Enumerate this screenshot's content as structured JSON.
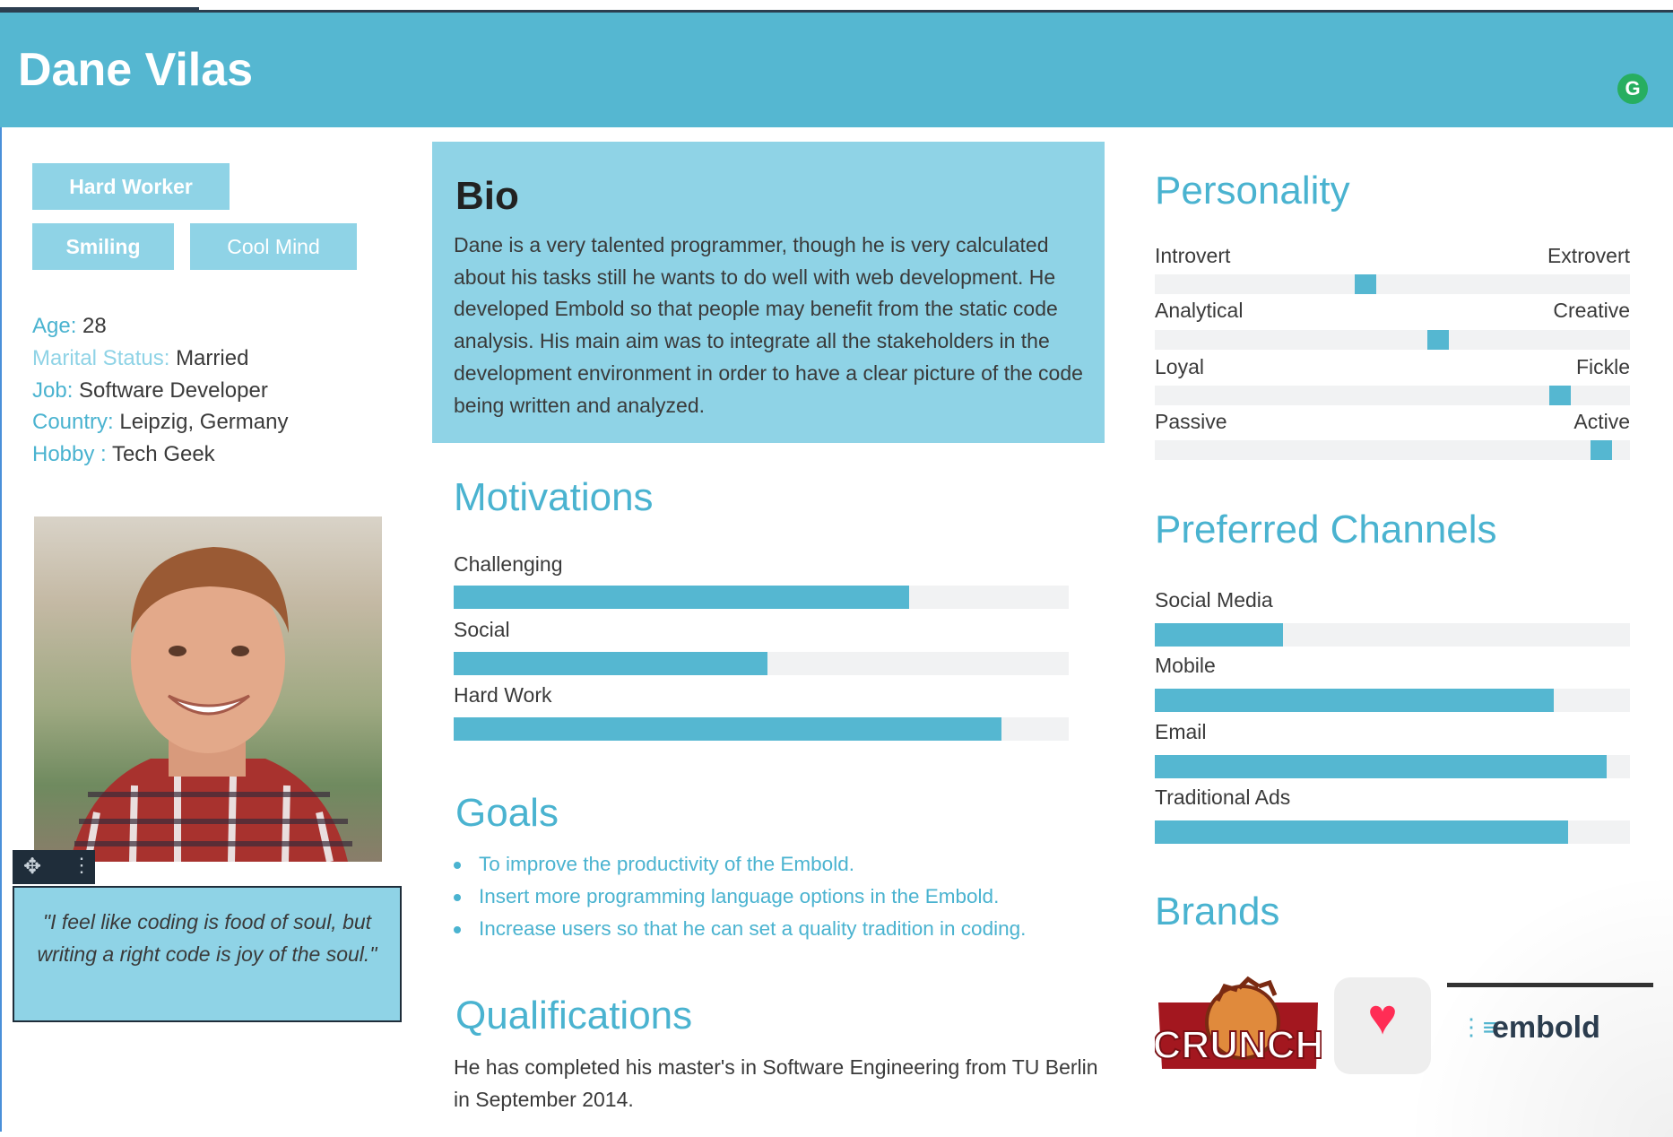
{
  "header": {
    "name": "Dane Vilas",
    "badge": "G"
  },
  "tags": [
    "Hard Worker",
    "Smiling",
    "Cool Mind"
  ],
  "info": [
    {
      "key": "Age",
      "sep": ": ",
      "value": "28"
    },
    {
      "key": "Marital Status",
      "sep": ": ",
      "value": "Married"
    },
    {
      "key": "Job",
      "sep": ":  ",
      "value": "Software Developer"
    },
    {
      "key": "Country",
      "sep": ": ",
      "value": "Leipzig, Germany"
    },
    {
      "key": "Hobby",
      "sep": " : ",
      "value": "Tech Geek"
    }
  ],
  "photo": {
    "alt": "Portrait of Dane Vilas"
  },
  "quote": "\"I feel like coding is food of soul, but writing a right code is joy of the soul.\"",
  "bio": {
    "title": "Bio",
    "text": "Dane is a very talented programmer, though he is very calculated about his tasks still he wants to do well with web development. He developed Embold so that people may benefit from the static code analysis. His main aim was to integrate all the stakeholders in the development environment in order to have a clear picture of the code being written and analyzed."
  },
  "motivations": {
    "title": "Motivations",
    "items": [
      {
        "label": "Challenging",
        "level": 0.74
      },
      {
        "label": "Social",
        "level": 0.51
      },
      {
        "label": "Hard Work",
        "level": 0.89
      }
    ]
  },
  "goals": {
    "title": "Goals",
    "items": [
      "To improve the productivity of the Embold.",
      "Insert more programming language options in the Embold.",
      "Increase users so that he can set a quality tradition in coding."
    ]
  },
  "qualifications": {
    "title": "Qualifications",
    "text": "He has completed his master's in Software Engineering from TU Berlin in September 2014."
  },
  "personality": {
    "title": "Personality",
    "traits": [
      {
        "left": "Introvert",
        "right": "Extrovert",
        "level": 0.44
      },
      {
        "left": "Analytical",
        "right": "Creative",
        "level": 0.6
      },
      {
        "left": "Loyal",
        "right": "Fickle",
        "level": 0.87
      },
      {
        "left": "Passive",
        "right": "Active",
        "level": 0.96
      }
    ]
  },
  "channels": {
    "title": "Preferred Channels",
    "items": [
      {
        "label": "Social Media",
        "level": 0.27
      },
      {
        "label": "Mobile",
        "level": 0.84
      },
      {
        "label": "Email",
        "level": 0.95
      },
      {
        "label": "Traditional Ads",
        "level": 0.87
      }
    ]
  },
  "brands": {
    "title": "Brands",
    "items": [
      {
        "name": "CRUNCH",
        "icon": "crunch-logo"
      },
      {
        "name": "Health",
        "icon": "heart-icon"
      },
      {
        "name": "embold",
        "icon": "embold-logo"
      }
    ]
  },
  "colors": {
    "accent": "#55b7d1",
    "light_accent": "#8fd3e6",
    "track": "#f1f2f3",
    "text": "#3a3a3a"
  }
}
